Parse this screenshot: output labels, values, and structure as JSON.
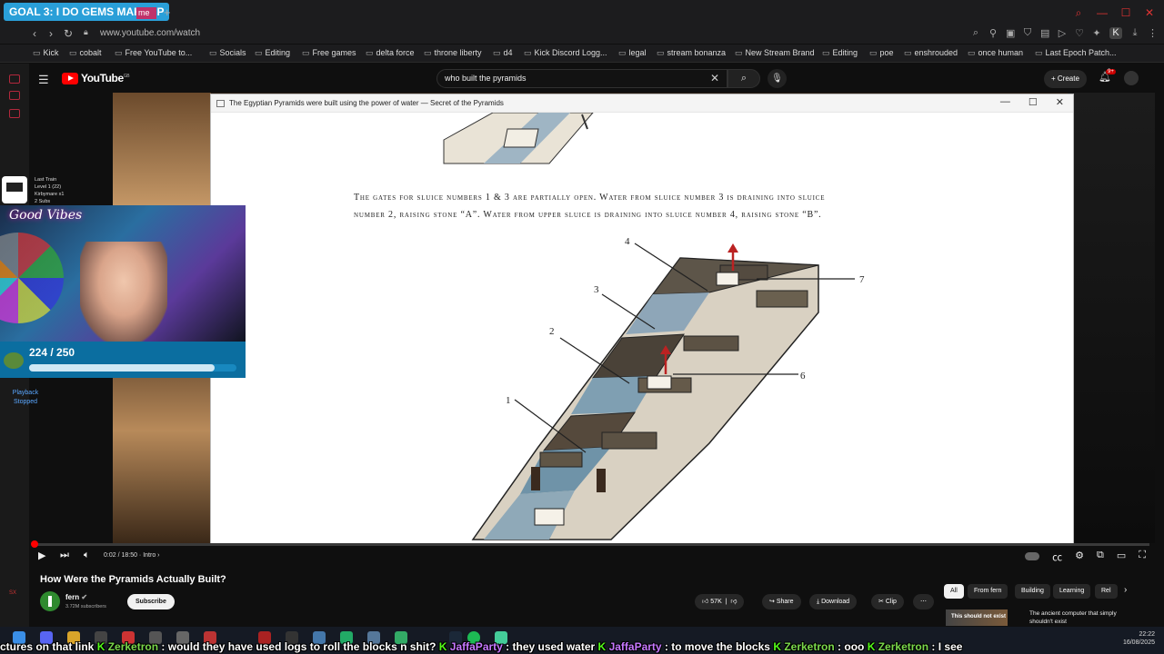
{
  "stream": {
    "goal_badge": "GOAL 3: I DO GEMS MAKEUP",
    "tab_fragment": "me",
    "widget_lines": [
      "Last Train",
      "Level 1  (22)",
      "Kirbymare x1",
      "2 Subs"
    ],
    "webcam_overlay": "Good Vibes",
    "sub_count": "224 / 250",
    "sub_progress": 0.896,
    "playback_status": "Playback Stopped"
  },
  "browser": {
    "url": "www.youtube.com/watch",
    "bookmarks": [
      "Kick",
      "cobalt",
      "Free YouTube to...",
      "Socials",
      "Editing",
      "Free games",
      "delta force",
      "throne liberty",
      "d4",
      "Kick Discord Logg...",
      "legal",
      "stream bonanza",
      "New Stream Brand",
      "Editing",
      "poe",
      "enshrouded",
      "once human",
      "Last Epoch Patch..."
    ]
  },
  "youtube": {
    "logo": "YouTube",
    "logo_region": "GB",
    "search_query": "who built the pyramids",
    "create_label": "Create",
    "notif_count": "9+",
    "video_time": "0:02 / 18:50",
    "chapter": "Intro",
    "progress_fraction": 0.002,
    "video_title": "How Were the Pyramids Actually Built?",
    "channel": "fern",
    "subscribers": "3.72M subscribers",
    "subscribe_label": "Subscribe",
    "likes": "57K",
    "share_label": "Share",
    "download_label": "Download",
    "clip_label": "Clip",
    "chips": [
      "All",
      "From fern",
      "Building",
      "Learning",
      "Rel"
    ],
    "rec_thumb_text": "This should not exist",
    "rec_title": "The ancient computer that simply shouldn't exist"
  },
  "inner_window": {
    "title": "The Egyptian Pyramids were built using the power of water — Secret of the Pyramids",
    "caption_line1": "The gates for sluice numbers 1 & 3 are partially open.  Water from sluice number 3 is draining into sluice",
    "caption_line2": "number 2, raising stone “A”.  Water from upper sluice is draining into sluice number 4, raising stone “B”.",
    "labels": [
      "1",
      "2",
      "3",
      "4",
      "6",
      "7"
    ]
  },
  "taskbar": {
    "time": "22:22",
    "date": "16/08/2025"
  },
  "chat": [
    {
      "user": "",
      "msg": "ctures on that link "
    },
    {
      "user": "Zerketron",
      "msg": "would they have used logs to roll the blocks n shit?"
    },
    {
      "user": "JaffaParty",
      "msg": "they used water"
    },
    {
      "user": "JaffaParty",
      "msg": "to move the blocks"
    },
    {
      "user": "Zerketron",
      "msg": "ooo"
    },
    {
      "user": "Zerketron",
      "msg": "I see"
    }
  ]
}
